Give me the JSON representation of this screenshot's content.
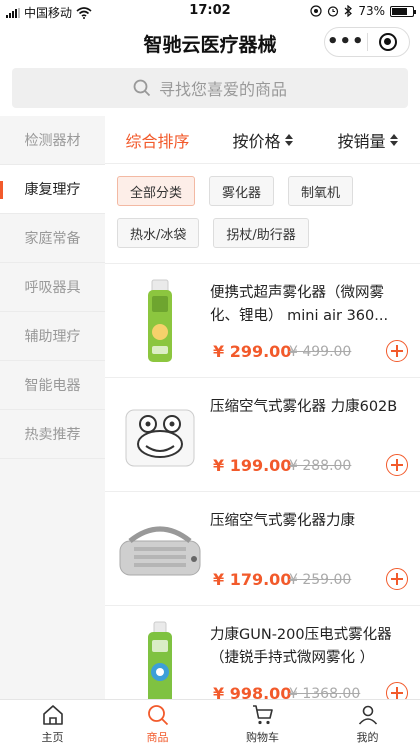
{
  "status": {
    "carrier": "中国移动",
    "time": "17:02",
    "battery": "73%"
  },
  "nav": {
    "title": "智驰云医疗器械",
    "more": "•••"
  },
  "search": {
    "placeholder": "寻找您喜爱的商品"
  },
  "sidebar": {
    "items": [
      {
        "label": "检测器材"
      },
      {
        "label": "康复理疗"
      },
      {
        "label": "家庭常备"
      },
      {
        "label": "呼吸器具"
      },
      {
        "label": "辅助理疗"
      },
      {
        "label": "智能电器"
      },
      {
        "label": "热卖推荐"
      }
    ],
    "active_index": 1
  },
  "sort": {
    "items": [
      {
        "label": "综合排序"
      },
      {
        "label": "按价格"
      },
      {
        "label": "按销量"
      }
    ]
  },
  "categories": [
    {
      "label": "全部分类"
    },
    {
      "label": "雾化器"
    },
    {
      "label": "制氧机"
    },
    {
      "label": "热水/冰袋"
    },
    {
      "label": "拐杖/助行器"
    }
  ],
  "products": [
    {
      "name": "便携式超声雾化器（微网雾化、锂电） mini air 360...",
      "price": "¥ 299.00",
      "old_price": "¥ 499.00"
    },
    {
      "name": "压缩空气式雾化器 力康602B",
      "price": "¥ 199.00",
      "old_price": "¥ 288.00"
    },
    {
      "name": "压缩空气式雾化器力康",
      "price": "¥ 179.00",
      "old_price": "¥ 259.00"
    },
    {
      "name": "力康GUN-200压电式雾化器（捷锐手持式微网雾化 ）",
      "price": "¥ 998.00",
      "old_price": "¥ 1368.00"
    }
  ],
  "tabbar": {
    "items": [
      {
        "label": "主页"
      },
      {
        "label": "商品"
      },
      {
        "label": "购物车"
      },
      {
        "label": "我的"
      }
    ]
  },
  "colors": {
    "accent": "#f25a2b",
    "sidebar_bg": "#f5f5f5"
  }
}
